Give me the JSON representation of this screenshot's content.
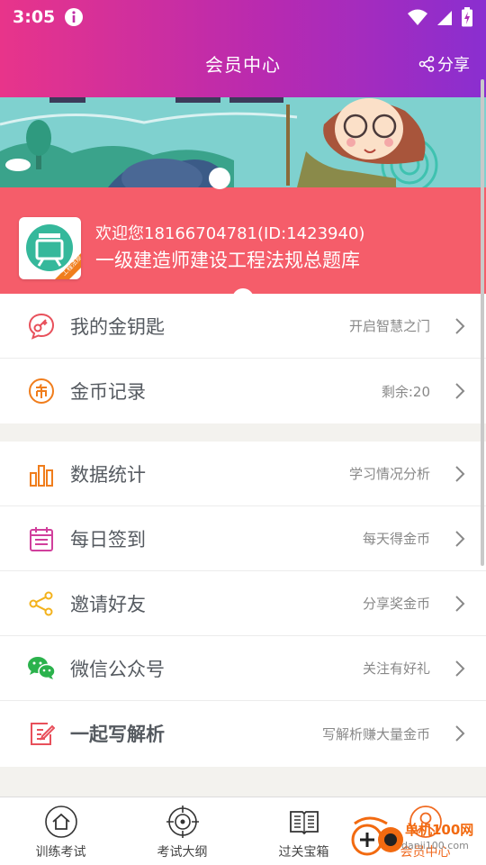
{
  "status_bar": {
    "time": "3:05"
  },
  "header": {
    "title": "会员中心",
    "share_label": "分享"
  },
  "banner": {
    "welcome": "欢迎您18166704781(ID:1423940)",
    "bank_name": "一级建造师建设工程法规总题库",
    "avatar_badge": "工程法规"
  },
  "menu_group_1": [
    {
      "label": "我的金钥匙",
      "hint": "开启智慧之门",
      "icon": "key-chat-icon",
      "color": "#e8505b"
    },
    {
      "label": "金币记录",
      "hint": "剩余:20",
      "icon": "coin-icon",
      "color": "#f07d1c"
    }
  ],
  "menu_group_2": [
    {
      "label": "数据统计",
      "hint": "学习情况分析",
      "icon": "bar-chart-icon",
      "color": "#f07d1c"
    },
    {
      "label": "每日签到",
      "hint": "每天得金币",
      "icon": "calendar-icon",
      "color": "#d13f9c"
    },
    {
      "label": "邀请好友",
      "hint": "分享奖金币",
      "icon": "share-nodes-icon",
      "color": "#f3b21c"
    },
    {
      "label": "微信公众号",
      "hint": "关注有好礼",
      "icon": "wechat-icon",
      "color": "#2bb24c"
    },
    {
      "label": "一起写解析",
      "hint": "写解析赚大量金币",
      "icon": "edit-icon",
      "color": "#e8505b"
    }
  ],
  "tabs": [
    {
      "label": "训练考试",
      "icon": "home-icon"
    },
    {
      "label": "考试大纲",
      "icon": "target-icon"
    },
    {
      "label": "过关宝箱",
      "icon": "book-icon"
    },
    {
      "label": "会员中心",
      "icon": "user-icon"
    }
  ],
  "watermark": {
    "line1": "单机100网",
    "line2": "danji100.com"
  }
}
